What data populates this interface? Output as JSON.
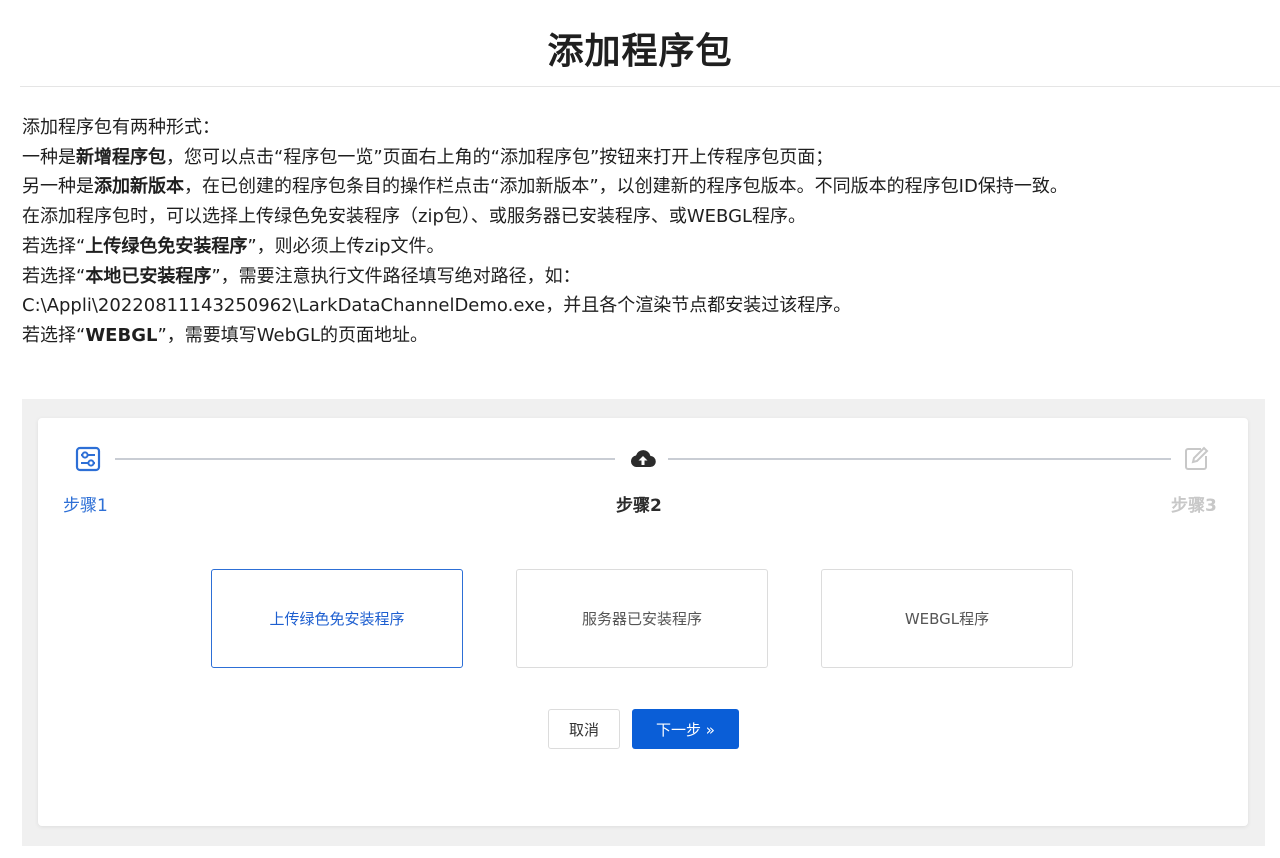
{
  "title": "添加程序包",
  "doc": {
    "line1": "添加程序包有两种形式：",
    "line2": {
      "pre": "一种是",
      "bold": "新增程序包",
      "post": "，您可以点击“程序包一览”页面右上角的“添加程序包”按钮来打开上传程序包页面；"
    },
    "line3": {
      "pre": "另一种是",
      "bold": "添加新版本",
      "post": "，在已创建的程序包条目的操作栏点击“添加新版本”，以创建新的程序包版本。不同版本的程序包ID保持一致。"
    },
    "line4": "在添加程序包时，可以选择上传绿色免安装程序（zip包）、或服务器已安装程序、或WEBGL程序。",
    "line5": {
      "pre": "若选择“",
      "bold": "上传绿色免安装程序",
      "post": "”，则必须上传zip文件。"
    },
    "line6": {
      "pre": "若选择“",
      "bold": "本地已安装程序",
      "post": "”，需要注意执行文件路径填写绝对路径，如："
    },
    "line7": "C:\\Appli\\20220811143250962\\LarkDataChannelDemo.exe，并且各个渲染节点都安装过该程序。",
    "line8": {
      "pre": "若选择“",
      "bold": "WEBGL",
      "post": "”，需要填写WebGL的页面地址。"
    }
  },
  "steps": [
    {
      "label": "步骤1",
      "icon": "settings-sliders-icon",
      "state": "done",
      "color": "#2d6fd6"
    },
    {
      "label": "步骤2",
      "icon": "cloud-upload-icon",
      "state": "active",
      "color": "#2b2b2b"
    },
    {
      "label": "步骤3",
      "icon": "edit-icon",
      "state": "pending",
      "color": "#c8c8c8"
    }
  ],
  "options": [
    {
      "label": "上传绿色免安装程序",
      "selected": true
    },
    {
      "label": "服务器已安装程序",
      "selected": false
    },
    {
      "label": "WEBGL程序",
      "selected": false
    }
  ],
  "buttons": {
    "cancel": "取消",
    "next": "下一步 »"
  }
}
